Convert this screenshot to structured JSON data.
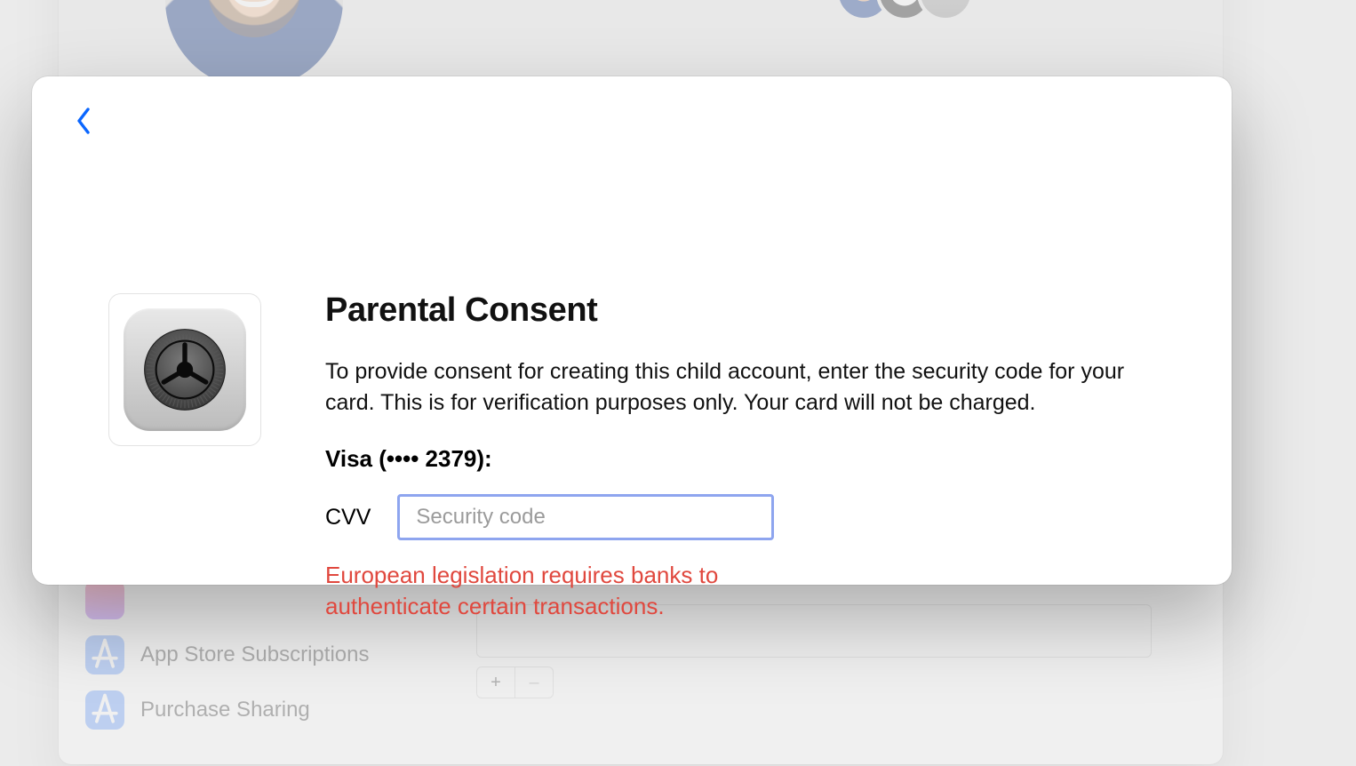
{
  "background": {
    "side_items": [
      {
        "label": ""
      },
      {
        "label": "App Store Subscriptions"
      },
      {
        "label": "Purchase Sharing"
      }
    ],
    "plus_label": "+",
    "minus_label": "–"
  },
  "sheet": {
    "title": "Parental Consent",
    "description": "To provide consent for creating this child account, enter the security code for your card. This is for verification purposes only. Your card will not be charged.",
    "card_line": "Visa (•••• 2379):",
    "cvv_label": "CVV",
    "cvv_placeholder": "Security code",
    "cvv_value": "",
    "warning": "European legislation requires banks to authenticate certain transactions."
  }
}
